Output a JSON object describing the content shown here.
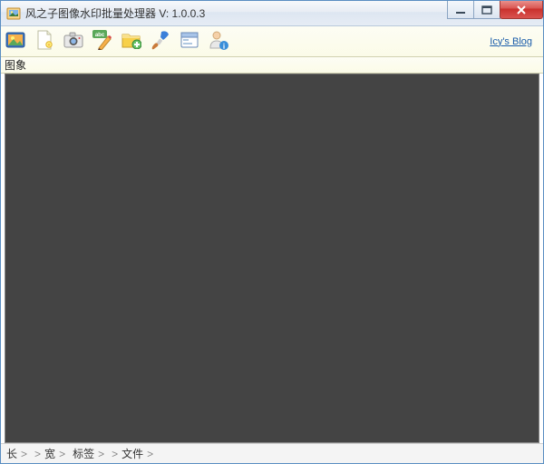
{
  "window": {
    "title": "风之子图像水印批量处理器  V: 1.0.0.3"
  },
  "toolbar": {
    "blog_link": "Icy's Blog",
    "icons": {
      "open_image": "open-image-icon",
      "new_page": "new-page-icon",
      "camera": "camera-icon",
      "text_watermark": "text-watermark-icon",
      "add_folder": "add-folder-icon",
      "brush": "brush-icon",
      "window_settings": "window-settings-icon",
      "user_info": "user-info-icon"
    }
  },
  "subheader": {
    "label": "图象"
  },
  "statusbar": {
    "length_label": "长",
    "width_label": "宽",
    "tags_label": "标签",
    "file_label": "文件",
    "sep": ">"
  }
}
